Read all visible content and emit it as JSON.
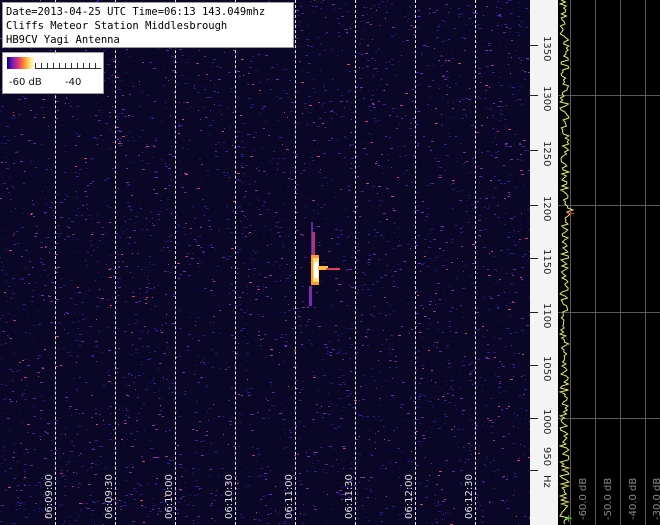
{
  "info": {
    "line1": "Date=2013-04-25 UTC Time=06:13 143.049mhz",
    "line2": "Cliffs Meteor Station Middlesbrough",
    "line3": "HB9CV Yagi Antenna"
  },
  "legend": {
    "min_label": "-60 dB",
    "max_label": "-40",
    "gradient": [
      "#000088",
      "#7a1fb0",
      "#e0307a",
      "#ff8a2a",
      "#ffe070",
      "#ffffff"
    ]
  },
  "time_axis": {
    "labels": [
      "06:09:00",
      "06:09:30",
      "06:10:00",
      "06:10:30",
      "06:11:00",
      "06:11:30",
      "06:12:00",
      "06:12:30"
    ]
  },
  "freq_axis": {
    "labels": [
      "1350",
      "1300",
      "1250",
      "1200",
      "1150",
      "1100",
      "1050",
      "1000",
      "950",
      "Hz"
    ]
  },
  "spectrum": {
    "db_labels": [
      "-60.0 dB",
      "-50.0 dB",
      "-40.0 dB",
      "-30.0 dB"
    ],
    "peak_marker": "+",
    "base_marker": "+"
  },
  "colors": {
    "background": "#0a0626",
    "trace": "#e8f060",
    "meteor_core": "#ffffff",
    "meteor_edge": "#ff9a30"
  }
}
